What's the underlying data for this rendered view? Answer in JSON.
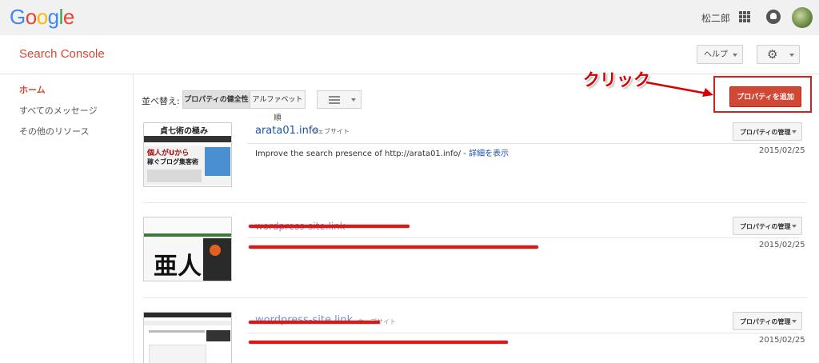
{
  "header": {
    "logo": [
      "G",
      "o",
      "o",
      "g",
      "l",
      "e"
    ],
    "logo_colors": [
      "#4285f4",
      "#ea4335",
      "#fbbc05",
      "#4285f4",
      "#34a853",
      "#ea4335"
    ],
    "user_name": "松二郎"
  },
  "subheader": {
    "title": "Search Console",
    "help_label": "ヘルプ"
  },
  "sidebar": {
    "items": [
      {
        "label": "ホーム",
        "active": true
      },
      {
        "label": "すべてのメッセージ",
        "active": false
      },
      {
        "label": "その他のリソース",
        "active": false
      }
    ]
  },
  "toolbar": {
    "sort_label": "並べ替え:",
    "sort_options": [
      "プロパティの健全性",
      "アルファベット順"
    ],
    "add_property_label": "プロパティを追加"
  },
  "annotation": {
    "text": "クリック",
    "color": "#d80000"
  },
  "properties": [
    {
      "name": "arata01.info",
      "type": "ウェブサイト",
      "desc": "Improve the search presence of http://arata01.info/ -",
      "desc_link": "詳細を表示",
      "date": "2015/02/25",
      "manage_label": "プロパティの管理",
      "thumb_text": "稼ぐブログ集客術",
      "thumb_top_text": "個人がUから",
      "thumb_logo": "貞七術の極み"
    },
    {
      "name": "",
      "date": "2015/02/25",
      "manage_label": "プロパティの管理",
      "thumb_text": "亜人"
    },
    {
      "name": "wordpress-site.link",
      "type": "ウェブサイト",
      "date": "2015/02/25",
      "manage_label": "プロパティの管理"
    }
  ]
}
